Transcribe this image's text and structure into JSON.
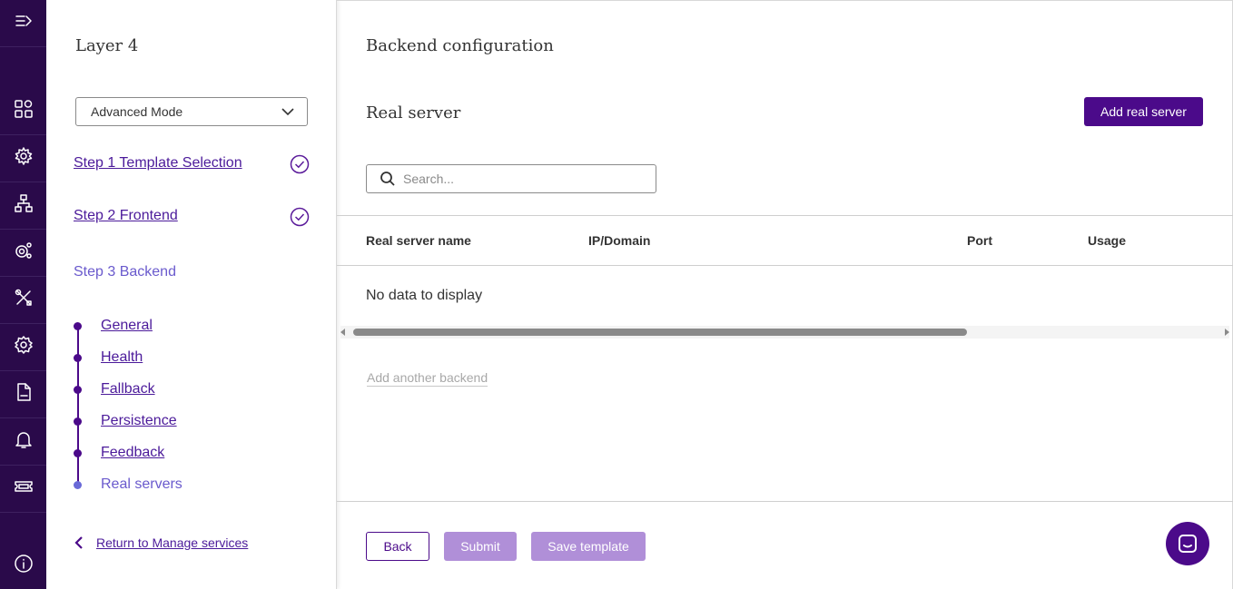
{
  "rail": {
    "items": [
      {
        "icon": "expand-menu-icon"
      },
      {
        "icon": "dashboard-grid-icon"
      },
      {
        "icon": "services-gear-icon"
      },
      {
        "icon": "network-topology-icon"
      },
      {
        "icon": "multi-gear-icon"
      },
      {
        "icon": "tools-icon"
      },
      {
        "icon": "settings-icon"
      },
      {
        "icon": "log-file-icon"
      },
      {
        "icon": "bell-icon"
      },
      {
        "icon": "ticket-icon"
      },
      {
        "icon": "info-icon"
      }
    ]
  },
  "panel": {
    "title": "Layer 4",
    "mode_select": "Advanced Mode",
    "steps": [
      {
        "label": "Step 1 Template Selection",
        "completed": true
      },
      {
        "label": "Step 2 Frontend",
        "completed": true
      },
      {
        "label": "Step 3 Backend",
        "completed": false
      }
    ],
    "sub_steps": [
      {
        "label": "General"
      },
      {
        "label": "Health"
      },
      {
        "label": "Fallback"
      },
      {
        "label": "Persistence"
      },
      {
        "label": "Feedback"
      },
      {
        "label": "Real servers"
      }
    ],
    "return_label": "Return to Manage services"
  },
  "main": {
    "title": "Backend configuration",
    "section_title": "Real server",
    "add_button": "Add real server",
    "search_placeholder": "Search...",
    "columns": [
      "Real server name",
      "IP/Domain",
      "Port",
      "Usage"
    ],
    "empty_text": "No data to display",
    "add_backend": "Add another backend",
    "buttons": {
      "back": "Back",
      "submit": "Submit",
      "save_template": "Save template"
    }
  },
  "colors": {
    "rail_bg": "#2a0a4a",
    "primary": "#4b0a8a",
    "primary_disabled": "#b08fd8",
    "current_step": "#6a5acd"
  }
}
